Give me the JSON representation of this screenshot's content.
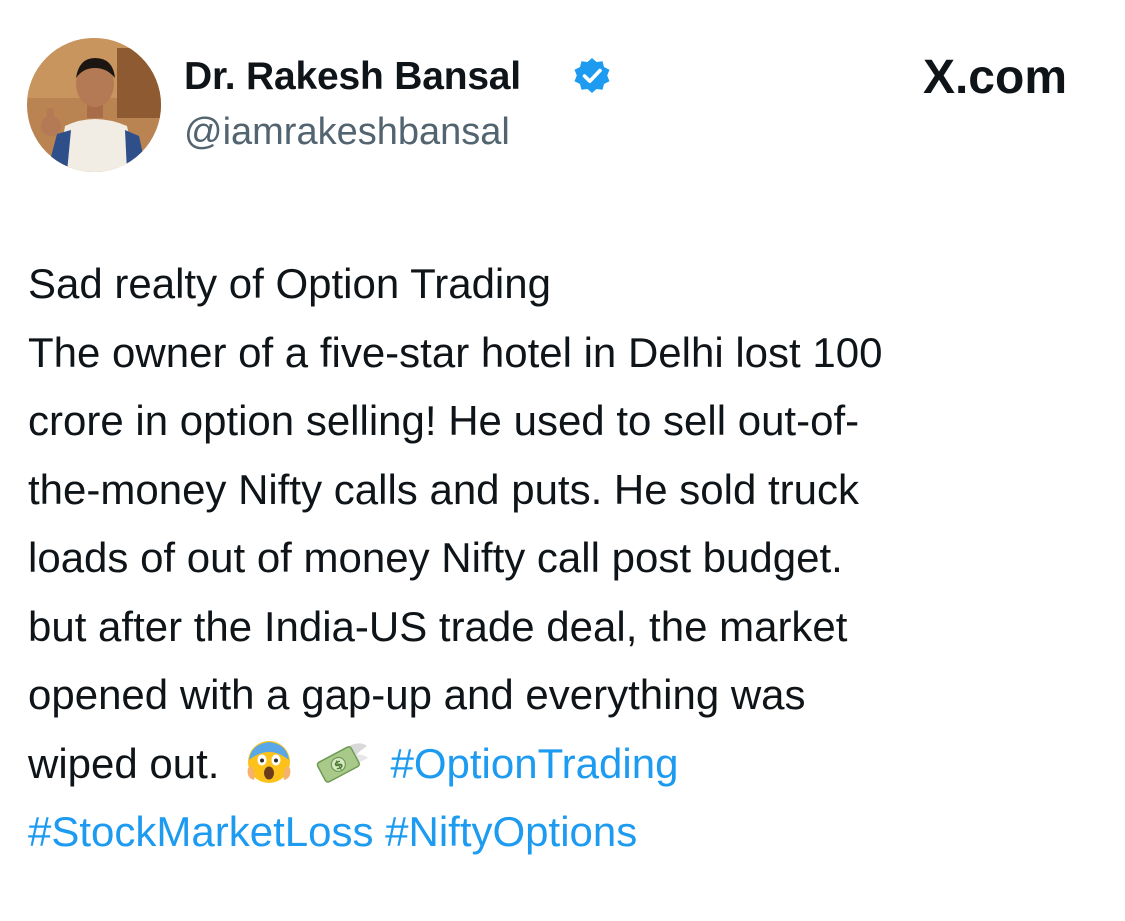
{
  "header": {
    "author_name": "Dr. Rakesh Bansal",
    "handle": "@iamrakeshbansal",
    "brand": "X.com",
    "verified_icon": "verified-badge-icon",
    "verified_color": "#1d9bf0"
  },
  "post": {
    "lines": [
      "Sad realty of Option Trading",
      "The owner of a five-star hotel in Delhi  lost 100",
      "crore in option selling! He used to sell out-of-",
      "the-money Nifty calls and puts. He sold truck",
      "loads of out of money Nifty call post budget.",
      "but after the India-US trade deal, the market",
      "opened with a gap-up and everything was"
    ],
    "last_line_text": "wiped out.",
    "emojis": [
      "screaming-face-emoji",
      "money-with-wings-emoji"
    ],
    "hashtags": [
      "#OptionTrading",
      "#StockMarketLoss",
      "#NiftyOptions"
    ],
    "hashtag_color": "#1d9bf0"
  }
}
